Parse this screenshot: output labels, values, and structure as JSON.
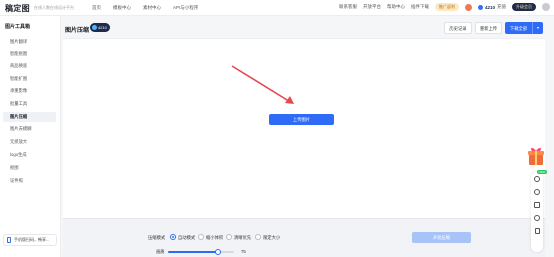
{
  "topbar": {
    "logo": "稿定图",
    "slogan": "在线人数在线设计平台",
    "nav": [
      "首页",
      "模板中心",
      "素材中心",
      "API与小程序"
    ],
    "right": {
      "contact": "联系客服",
      "open_platform": "开放平台",
      "help": "帮助中心",
      "download": "插件下载",
      "promo": "推广返利",
      "coins": "4210",
      "recharge": "充值",
      "vip": "升级会员"
    }
  },
  "sidebar": {
    "title": "图片工具箱",
    "items": [
      {
        "label": "图片翻译",
        "active": false
      },
      {
        "label": "智能抠图",
        "active": false
      },
      {
        "label": "商品换底",
        "active": false
      },
      {
        "label": "智能扩图",
        "active": false
      },
      {
        "label": "承重影像",
        "active": false
      },
      {
        "label": "批量工具",
        "active": false
      },
      {
        "label": "图片压缩",
        "active": true
      },
      {
        "label": "图片去模糊",
        "active": false
      },
      {
        "label": "无损放大",
        "active": false
      },
      {
        "label": "logo生成",
        "active": false
      },
      {
        "label": "抠图",
        "active": false
      },
      {
        "label": "证件照",
        "active": false
      }
    ],
    "bottom": "手机版扫码，畅享..."
  },
  "page": {
    "title": "图片压缩",
    "count": "4210",
    "buttons": {
      "history": "历史记录",
      "reupload": "重新上传",
      "download_all": "下载全部"
    },
    "upload_label": "上传图片"
  },
  "settings": {
    "mode_label": "压缩模式",
    "options": [
      {
        "label": "自动模式",
        "selected": true
      },
      {
        "label": "缩小体积",
        "selected": false
      },
      {
        "label": "清晰优先",
        "selected": false
      },
      {
        "label": "限定大小",
        "selected": false
      }
    ],
    "start_label": "开始压缩",
    "quality_label": "画质",
    "quality_value": 75,
    "quality_fraction": 0.75
  },
  "float_toolbar": {
    "new_badge": "NEW",
    "icons": [
      "gift-icon",
      "ai-icon",
      "plus-circle-icon",
      "qrcode-icon",
      "question-icon",
      "phone-icon"
    ]
  },
  "colors": {
    "primary": "#2f6bf6",
    "arrow": "#e5484d",
    "sidebar_active": "#eef1f6"
  }
}
